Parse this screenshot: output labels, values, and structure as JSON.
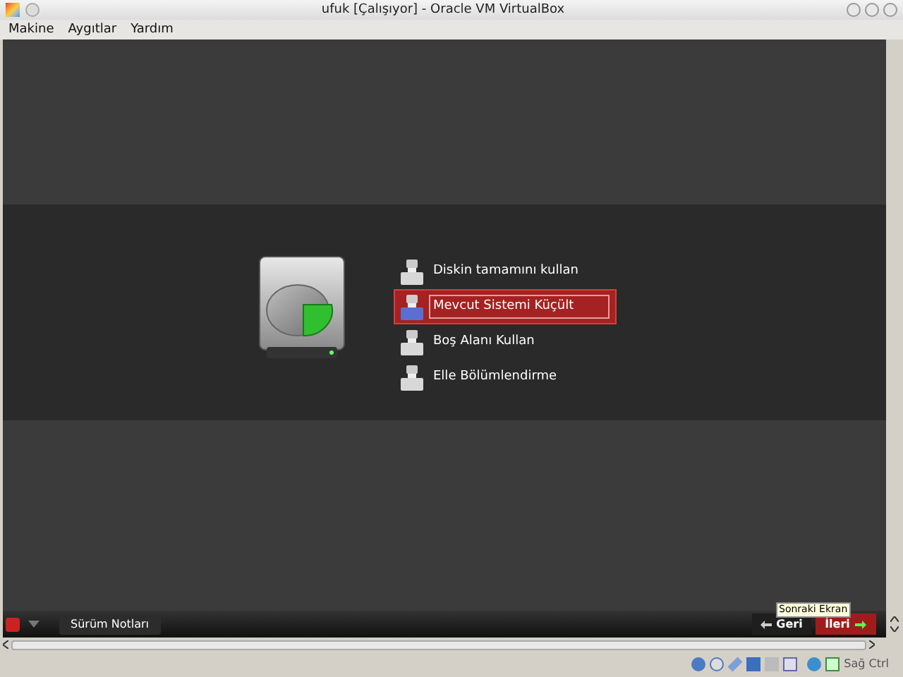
{
  "window": {
    "title": "ufuk [Çalışıyor] - Oracle VM VirtualBox"
  },
  "menu": [
    {
      "label": "Makine"
    },
    {
      "label": "Aygıtlar"
    },
    {
      "label": "Yardım"
    }
  ],
  "options": [
    {
      "label": "Diskin tamamını kullan",
      "selected": false
    },
    {
      "label": "Mevcut Sistemi Küçült",
      "selected": true
    },
    {
      "label": "Boş Alanı Kullan",
      "selected": false
    },
    {
      "label": "Elle Bölümlendirme",
      "selected": false
    }
  ],
  "bottom_bar": {
    "release_notes": "Sürüm Notları",
    "back": "Geri",
    "next": "İleri",
    "tooltip": "Sonraki Ekran"
  },
  "status_bar": {
    "host_key": "Sağ Ctrl"
  }
}
